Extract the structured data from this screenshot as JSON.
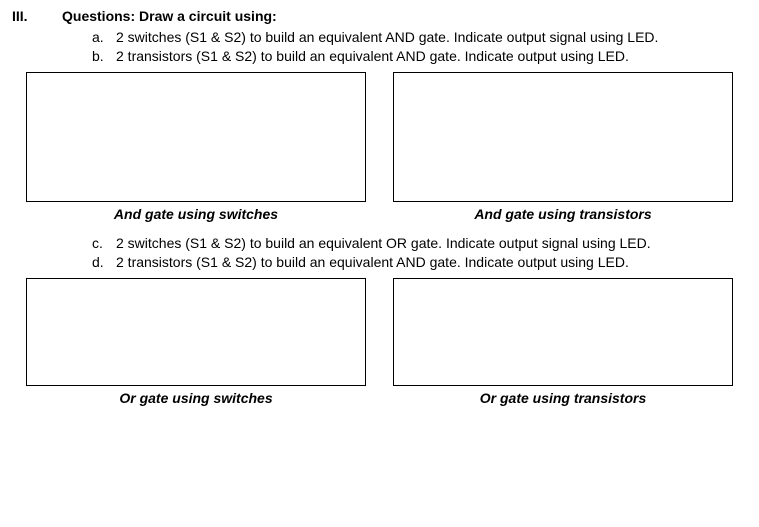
{
  "section": {
    "numeral": "III.",
    "title": "Questions: Draw a circuit using:"
  },
  "group1": {
    "items": [
      {
        "letter": "a.",
        "text": "2 switches (S1 & S2) to build an equivalent AND gate. Indicate output signal using LED."
      },
      {
        "letter": "b.",
        "text": "2 transistors (S1 & S2) to build an equivalent AND gate. Indicate output using LED."
      }
    ],
    "captions": {
      "left": "And gate using switches",
      "right": "And gate using transistors"
    }
  },
  "group2": {
    "items": [
      {
        "letter": "c.",
        "text": "2 switches (S1 & S2) to build an equivalent OR gate. Indicate output signal using LED."
      },
      {
        "letter": "d.",
        "text": "2 transistors (S1 & S2) to build an equivalent AND gate. Indicate output using LED."
      }
    ],
    "captions": {
      "left": "Or gate using switches",
      "right": "Or gate using transistors"
    }
  }
}
